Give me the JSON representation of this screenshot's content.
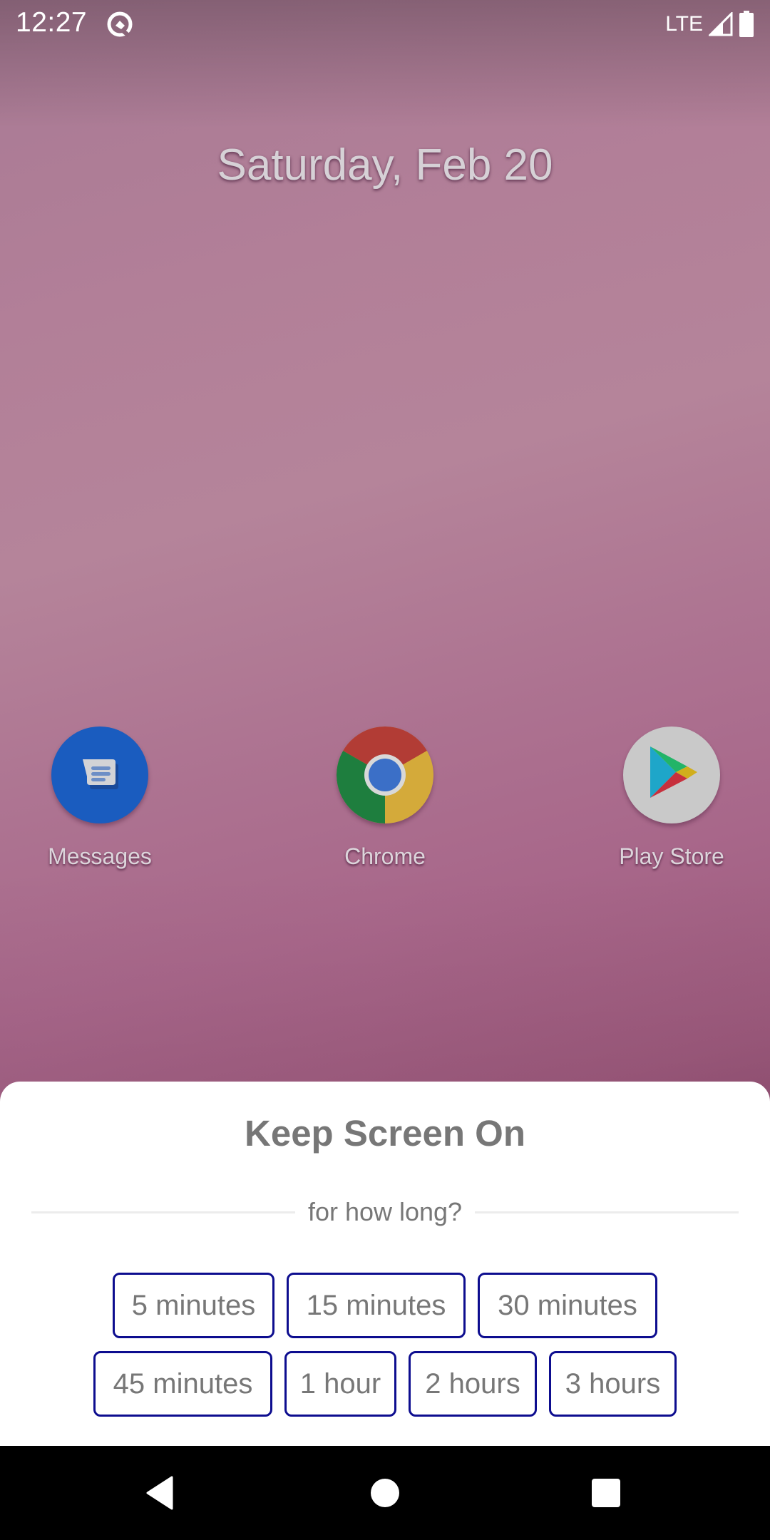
{
  "status_bar": {
    "time": "12:27",
    "app_icon": "android-q-icon",
    "network": "LTE",
    "signal_icon": "signal-icon",
    "battery_icon": "battery-full-icon"
  },
  "home": {
    "date": "Saturday, Feb 20",
    "apps": [
      {
        "label": "Messages",
        "icon": "messages-icon",
        "color": "#1a5cbf"
      },
      {
        "label": "Chrome",
        "icon": "chrome-icon"
      },
      {
        "label": "Play Store",
        "icon": "play-store-icon"
      }
    ]
  },
  "sheet": {
    "title": "Keep Screen On",
    "subtitle": "for how long?",
    "accent_color": "#0d0d8f",
    "options_row1": [
      "5 minutes",
      "15 minutes",
      "30 minutes"
    ],
    "options_row2": [
      "45 minutes",
      "1 hour",
      "2 hours",
      "3 hours"
    ]
  },
  "nav_bar": {
    "back": "back-icon",
    "home": "home-icon",
    "recents": "recents-icon"
  }
}
